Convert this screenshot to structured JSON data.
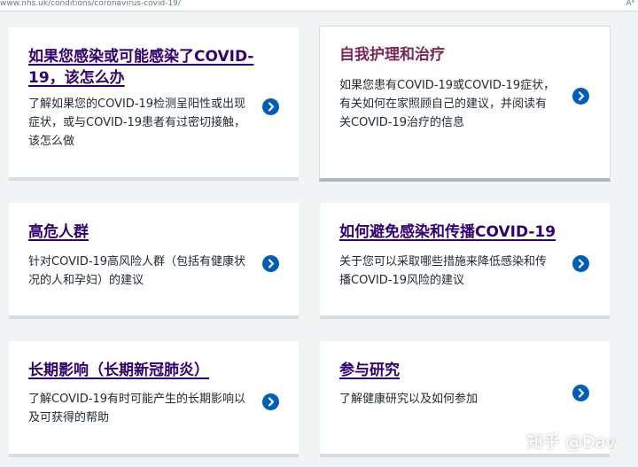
{
  "browser": {
    "url": "www.nhs.uk/conditions/coronavirus-covid-19/",
    "reader_icon": "reader-mode-icon",
    "reader_label": "Aᵃ"
  },
  "cards": [
    {
      "title": "如果您感染或可能感染了COVID-19，该怎么办",
      "title_line1": "如果您感染或可能感染了COVID-",
      "title_line2": "19，该怎么办",
      "desc_lines": [
        "了解如果您的COVID-19检测呈阳性或出现",
        "症状，或与COVID-19患者有过密切接触，",
        "该怎么做"
      ]
    },
    {
      "title": "自我护理和治疗",
      "desc_lines": [
        "如果您患有COVID-19或COVID-19症状，",
        "有关如何在家照顾自己的建议，并阅读有",
        "关COVID-19治疗的信息"
      ]
    },
    {
      "title": "高危人群",
      "desc_lines": [
        "针对COVID-19高风险人群（包括有健康状",
        "况的人和孕妇）的建议"
      ]
    },
    {
      "title": "如何避免感染和传播COVID-19",
      "desc_lines": [
        "关于您可以采取哪些措施来降低感染和传",
        "播COVID-19风险的建议"
      ]
    },
    {
      "title": "长期影响（长期新冠肺炎）",
      "desc_lines": [
        "了解COVID-19有时可能产生的长期影响以",
        "及可获得的帮助"
      ]
    },
    {
      "title": "参与研究",
      "desc_lines": [
        "了解健康研究以及如何参加"
      ]
    }
  ],
  "watermark": "知乎 @Dav",
  "colors": {
    "link": "#330072",
    "link_hover": "#7c2855",
    "arrow": "#005eb8",
    "background": "#f0f4f5",
    "text": "#212b32"
  },
  "icons": {
    "arrow": "chevron-right-circle-icon"
  }
}
